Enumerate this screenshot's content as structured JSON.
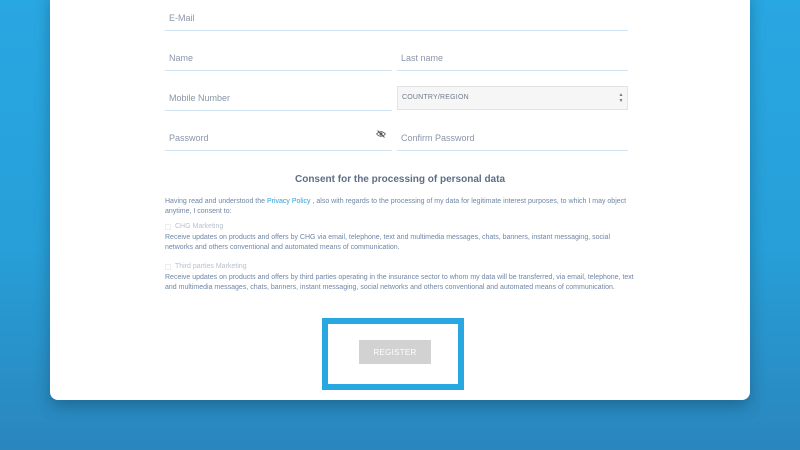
{
  "form": {
    "email_label": "E-Mail",
    "name_label": "Name",
    "last_name_label": "Last name",
    "mobile_label": "Mobile Number",
    "country_select_value": "COUNTRY/REGION",
    "password_label": "Password",
    "confirm_password_label": "Confirm Password"
  },
  "consent": {
    "title": "Consent for the processing of personal data",
    "intro_before": "Having read and understood the ",
    "privacy_link": "Privacy Policy",
    "intro_after": " , also with regards to the processing of my data for legitimate interest purposes, to which I may object anytime, I consent to:",
    "options": [
      {
        "title": "CHG Marketing",
        "text": "Receive updates on products and offers by CHG via email, telephone, text and multimedia messages, chats, banners, instant messaging, social networks and others conventional and automated means of communication."
      },
      {
        "title": "Third parties Marketing",
        "text": "Receive updates on products and offers by third parties operating in the insurance sector to whom my data will be transferred, via email, telephone, text and multimedia messages, chats, banners, instant messaging, social networks and others conventional and automated means of communication."
      }
    ]
  },
  "register_label": "REGISTER",
  "colors": {
    "background": "#29a7e2",
    "highlight_frame": "#29a7e2",
    "link": "#2a9fe0",
    "button_disabled": "#d2d2d2"
  }
}
